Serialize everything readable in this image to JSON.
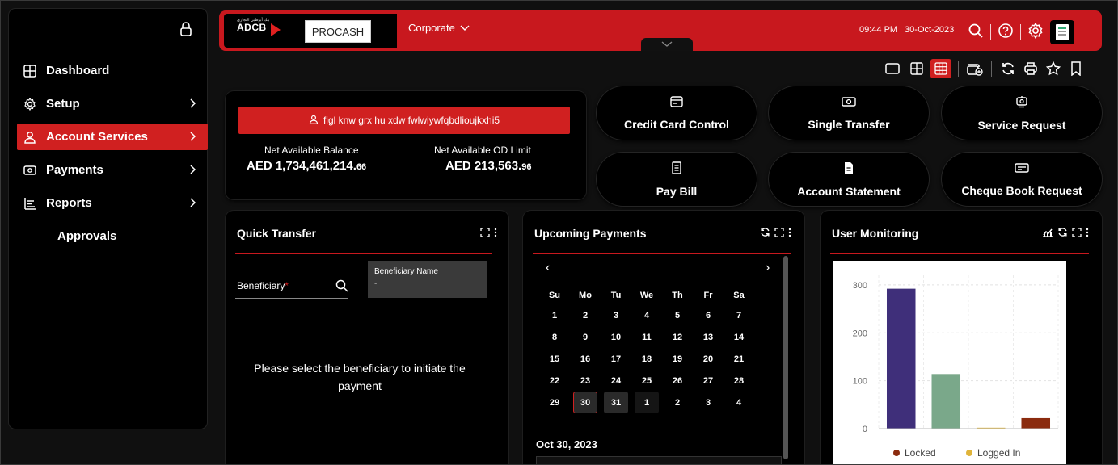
{
  "sidebar": {
    "items": [
      {
        "label": "Dashboard",
        "icon": "dashboard-icon",
        "has_chevron": false,
        "active": false
      },
      {
        "label": "Setup",
        "icon": "settings-icon",
        "has_chevron": true,
        "active": false
      },
      {
        "label": "Account Services",
        "icon": "user-icon",
        "has_chevron": true,
        "active": true
      },
      {
        "label": "Payments",
        "icon": "payments-icon",
        "has_chevron": true,
        "active": false
      },
      {
        "label": "Reports",
        "icon": "reports-icon",
        "has_chevron": true,
        "active": false
      },
      {
        "label": "Approvals",
        "icon": "",
        "has_chevron": false,
        "active": false
      }
    ]
  },
  "header": {
    "bank_name": "ADCB",
    "bank_arabic": "بنك أبوظبي التجاري",
    "product": "PROCASH",
    "entity": "Corporate",
    "datetime": "09:44 PM | 30-Oct-2023",
    "accent": "#c8181e"
  },
  "account": {
    "name": "figl knw grx hu xdw fwlwiywfqbdlioujkxhi5",
    "net_available_balance_label": "Net Available Balance",
    "net_available_balance_main": "AED 1,734,461,214.",
    "net_available_balance_dec": "66",
    "net_od_limit_label": "Net Available OD Limit",
    "net_od_limit_main": "AED 213,563.",
    "net_od_limit_dec": "96"
  },
  "quick_actions": [
    {
      "label": "Credit Card Control",
      "icon": "credit-card-icon"
    },
    {
      "label": "Single Transfer",
      "icon": "money-icon"
    },
    {
      "label": "Service Request",
      "icon": "service-icon"
    },
    {
      "label": "Pay Bill",
      "icon": "bill-icon"
    },
    {
      "label": "Account Statement",
      "icon": "statement-icon"
    },
    {
      "label": "Cheque Book Request",
      "icon": "cheque-icon"
    }
  ],
  "quick_transfer": {
    "title": "Quick Transfer",
    "beneficiary_label": "Beneficiary",
    "required_mark": "*",
    "beneficiary_name_title": "Beneficiary Name",
    "beneficiary_name_value": "-",
    "message": "Please select the beneficiary to initiate the payment"
  },
  "upcoming_payments": {
    "title": "Upcoming Payments",
    "prev": "‹",
    "next": "›",
    "weekdays": [
      "Su",
      "Mo",
      "Tu",
      "We",
      "Th",
      "Fr",
      "Sa"
    ],
    "weeks": [
      [
        "1",
        "2",
        "3",
        "4",
        "5",
        "6",
        "7"
      ],
      [
        "8",
        "9",
        "10",
        "11",
        "12",
        "13",
        "14"
      ],
      [
        "15",
        "16",
        "17",
        "18",
        "19",
        "20",
        "21"
      ],
      [
        "22",
        "23",
        "24",
        "25",
        "26",
        "27",
        "28"
      ],
      [
        "29",
        "30",
        "31",
        "1",
        "2",
        "3",
        "4"
      ]
    ],
    "selected_date": "Oct 30, 2023"
  },
  "user_monitoring": {
    "title": "User Monitoring"
  },
  "chart_data": {
    "type": "bar",
    "categories": [
      "Locked",
      "Logged In",
      "",
      ""
    ],
    "values": [
      292,
      114,
      2,
      22
    ],
    "colors": [
      "#3f2f7a",
      "#7aa88a",
      "#e0b43a",
      "#8b2b0e"
    ],
    "ylim": [
      0,
      320
    ],
    "yticks": [
      0,
      100,
      200,
      300
    ],
    "ytick_labels": [
      "0",
      "100",
      "200",
      "300"
    ],
    "legend": [
      {
        "name": "Locked",
        "color": "#8b2b0e"
      },
      {
        "name": "Logged In",
        "color": "#e0b43a"
      }
    ],
    "legend_position": "bottom",
    "grid": true
  }
}
